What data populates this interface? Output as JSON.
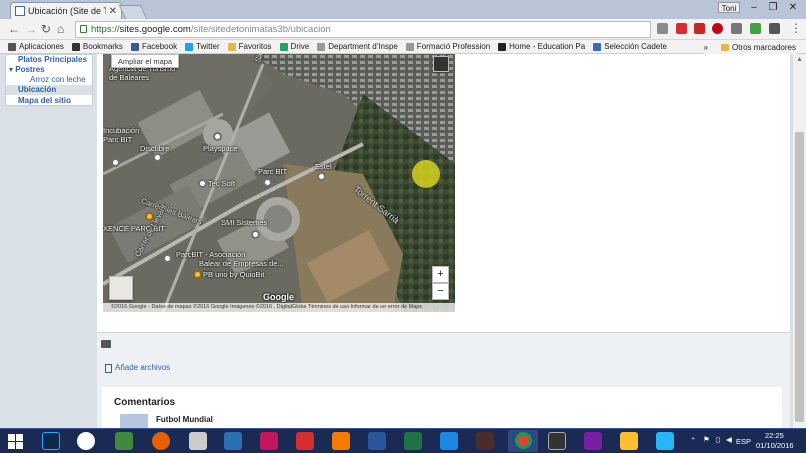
{
  "browser": {
    "tab_title": "Ubicación (Site de Toni M",
    "profile": "Toni",
    "url_scheme": "https://",
    "url_domain": "sites.google.com",
    "url_path": "/site/sitedetonimatas3b/ubicacion"
  },
  "bookmarks": [
    {
      "label": "Aplicaciones",
      "color": "#555555",
      "icon": "apps-icon"
    },
    {
      "label": "Bookmarks",
      "color": "#333333",
      "icon": "star-icon"
    },
    {
      "label": "Facebook",
      "color": "#3b5998",
      "icon": "facebook-icon"
    },
    {
      "label": "Twitter",
      "color": "#1da1f2",
      "icon": "twitter-icon"
    },
    {
      "label": "Favoritos",
      "color": "#e0b84d",
      "icon": "folder-icon"
    },
    {
      "label": "Drive",
      "color": "#1fa463",
      "icon": "drive-icon"
    },
    {
      "label": "Department d'Inspe",
      "color": "#999999",
      "icon": "page-icon"
    },
    {
      "label": "Formació Profession",
      "color": "#999999",
      "icon": "page-icon"
    },
    {
      "label": "Home - Education Pa",
      "color": "#222222",
      "icon": "home-icon"
    },
    {
      "label": "Selección Cadete",
      "color": "#3b6bb5",
      "icon": "page-icon"
    }
  ],
  "bookmarks_more": "»",
  "bookmarks_other": "Otros marcadores",
  "sitenav": {
    "items": [
      "Platos Principales",
      "Postres",
      "Arroz con leche",
      "Ubicación",
      "Mapa del sitio"
    ]
  },
  "map": {
    "enlarge_label": "Ampliar el mapa",
    "zoom_in": "+",
    "zoom_out": "−",
    "copyright": "©2016 Google - Datos de mapas ©2016 Google Imágenes ©2016 , DigitalGlobe   Términos de uso   Informar de un error de Maps",
    "labels": [
      "Agencia de Turismo",
      "de Baleares",
      "Incubación",
      "Parc BIT",
      "Playspace",
      "Discubre",
      "Tec Soft",
      "Parc BIT",
      "Estel",
      "Torrent Sarrià",
      "Carrer Illes Balears",
      "SMI Sistemes",
      "XENCE PARC BIT",
      "ParcBIT - Asociación",
      "Balear de Empresas de...",
      "PB uno by QuioBit",
      "Carrer de Llevant",
      "Sarria",
      "Google"
    ]
  },
  "files_label": "Añade archivos",
  "comments": {
    "title": "Comentarios",
    "first_author": "Futbol Mundial"
  },
  "taskbar": {
    "lang": "ESP",
    "time": "22:25",
    "date": "01/10/2016"
  },
  "colors": {
    "page_bg": "#d9e1e6",
    "taskbar": "#1b2a55",
    "link": "#2e62a8"
  }
}
